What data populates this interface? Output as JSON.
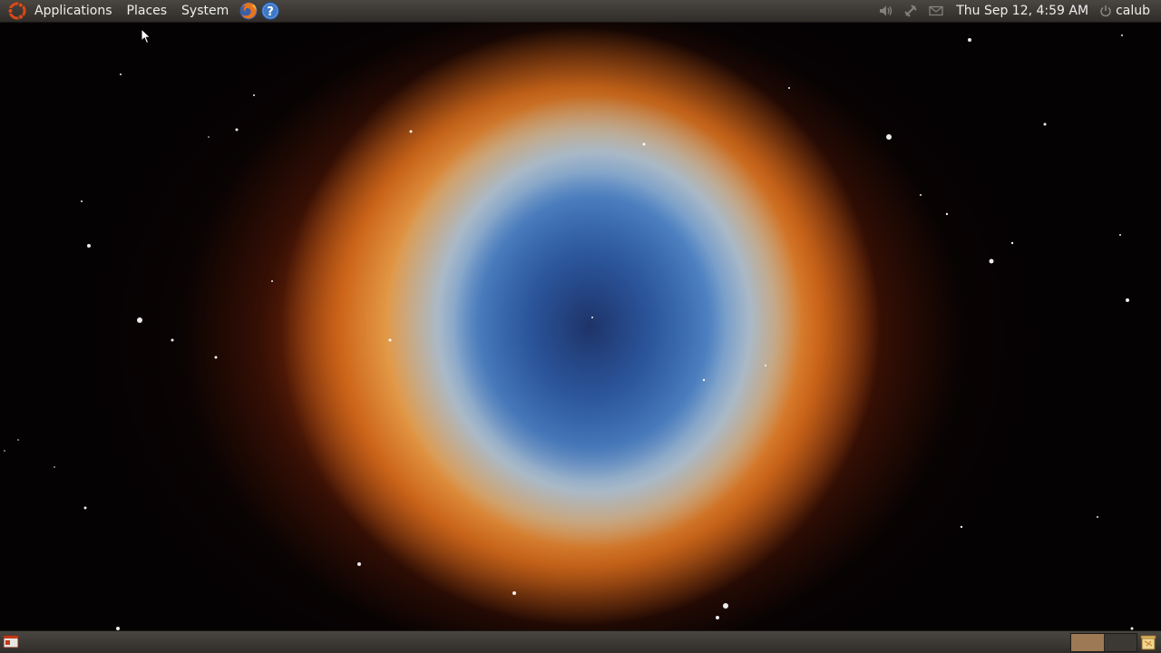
{
  "top_panel": {
    "menus": {
      "applications": "Applications",
      "places": "Places",
      "system": "System"
    },
    "launchers": [
      "firefox-icon",
      "help-icon"
    ],
    "tray": {
      "icons": [
        "volume-icon",
        "network-icon",
        "mail-icon"
      ],
      "clock": "Thu Sep 12,  4:59 AM",
      "user": "calub"
    }
  },
  "bottom_panel": {
    "workspaces": [
      {
        "active": true
      },
      {
        "active": false
      }
    ],
    "icons": [
      "show-desktop-icon",
      "trash-icon"
    ]
  },
  "desktop": {
    "wallpaper": "helix-nebula"
  },
  "colors": {
    "panel": "#3a3733",
    "panel_text": "#eeeeec",
    "ubuntu_orange": "#dd4814",
    "workspace_active": "#9d7a55"
  }
}
